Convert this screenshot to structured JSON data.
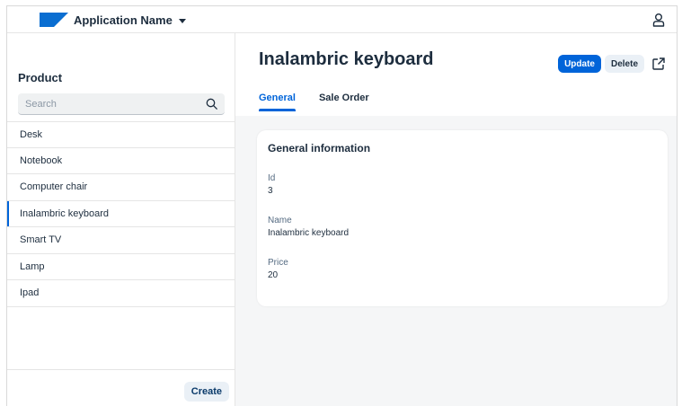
{
  "shell": {
    "app_title": "Application Name",
    "logo_icon": "sap-logo-icon",
    "user_icon": "user-icon",
    "brand_color": "#0064d9"
  },
  "master": {
    "title": "Product",
    "search": {
      "placeholder": "Search",
      "value": ""
    },
    "items": [
      {
        "label": "Desk"
      },
      {
        "label": "Notebook"
      },
      {
        "label": "Computer chair"
      },
      {
        "label": "Inalambric keyboard",
        "selected": true
      },
      {
        "label": "Smart TV"
      },
      {
        "label": "Lamp"
      },
      {
        "label": "Ipad"
      }
    ],
    "create_label": "Create"
  },
  "detail": {
    "title": "Inalambric keyboard",
    "update_label": "Update",
    "delete_label": "Delete",
    "tabs": [
      {
        "label": "General",
        "active": true
      },
      {
        "label": "Sale Order",
        "active": false
      }
    ],
    "section_title": "General information",
    "fields": [
      {
        "label": "Id",
        "value": "3"
      },
      {
        "label": "Name",
        "value": "Inalambric keyboard"
      },
      {
        "label": "Price",
        "value": "20"
      }
    ]
  }
}
